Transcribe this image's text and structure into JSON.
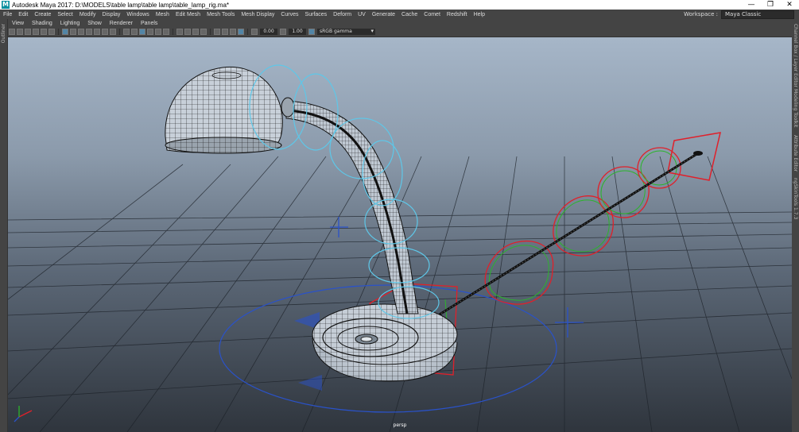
{
  "window": {
    "title": "Autodesk Maya 2017: D:\\MODELS\\table lamp\\table lamp\\table_lamp_rig.ma*",
    "logo": "M",
    "minimize": "—",
    "maximize": "❐",
    "close": "✕"
  },
  "menu": [
    "File",
    "Edit",
    "Create",
    "Select",
    "Modify",
    "Display",
    "Windows",
    "Mesh",
    "Edit Mesh",
    "Mesh Tools",
    "Mesh Display",
    "Curves",
    "Surfaces",
    "Deform",
    "UV",
    "Generate",
    "Cache",
    "Comet",
    "Redshift",
    "Help"
  ],
  "workspace": {
    "label": "Workspace :",
    "value": "Maya Classic"
  },
  "panel_menu": [
    "View",
    "Shading",
    "Lighting",
    "Show",
    "Renderer",
    "Panels"
  ],
  "toolbar": {
    "exposure": "0.00",
    "gamma": "1.00",
    "color_space": "sRGB gamma"
  },
  "left_panel_label": "Outliner",
  "right_panel_labels": [
    "Channel Box / Layer Editor",
    "Modeling Toolkit",
    "Attribute Editor",
    "ngSkinTools 1.7.3"
  ],
  "viewport": {
    "camera": "persp"
  },
  "colors": {
    "background_top": "#a6b6c8",
    "background_bottom": "#2f353d",
    "grid": "#1c2128",
    "mesh": "#111111",
    "control_cyan": "#5ec7e8",
    "control_blue": "#2a52c9",
    "control_red": "#e0202a",
    "control_green": "#2bb52b"
  },
  "icons": [
    "maya-logo-icon",
    "minimize-icon",
    "maximize-icon",
    "close-icon",
    "axis-gizmo-icon"
  ]
}
